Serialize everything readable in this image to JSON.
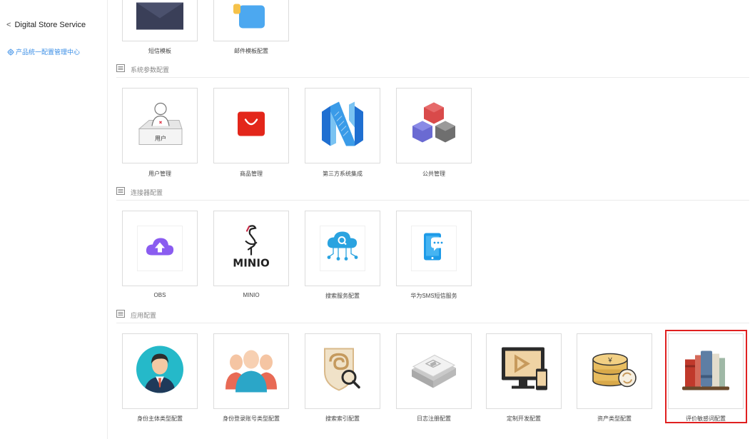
{
  "sidebar": {
    "back_label": "Digital Store Service",
    "config_center_label": "产品统一配置管理中心"
  },
  "sections": [
    {
      "title": "系统参数配置"
    },
    {
      "title": "连接器配置"
    },
    {
      "title": "应用配置"
    }
  ],
  "top_row": [
    {
      "label": "短信模板",
      "icon": "sms-template-icon"
    },
    {
      "label": "邮件模板配置",
      "icon": "email-template-icon"
    }
  ],
  "system_params": [
    {
      "label": "用户管理",
      "icon": "user-box-icon",
      "icon_text": "用户"
    },
    {
      "label": "商品管理",
      "icon": "shopping-bag-icon"
    },
    {
      "label": "第三方系统集成",
      "icon": "n-logo-icon"
    },
    {
      "label": "公共管理",
      "icon": "cubes-icon"
    }
  ],
  "connectors": [
    {
      "label": "OBS",
      "icon": "cloud-upload-icon"
    },
    {
      "label": "MINIO",
      "icon": "minio-logo-icon",
      "icon_text": "MINIO"
    },
    {
      "label": "搜索服务配置",
      "icon": "search-cloud-icon"
    },
    {
      "label": "华为SMS短信服务",
      "icon": "phone-chat-icon"
    }
  ],
  "apps": [
    {
      "label": "身份主体类型配置",
      "icon": "person-avatar-icon"
    },
    {
      "label": "身份登录账号类型配置",
      "icon": "people-group-icon"
    },
    {
      "label": "搜索索引配置",
      "icon": "shield-search-icon"
    },
    {
      "label": "日志注册配置",
      "icon": "log-device-icon"
    },
    {
      "label": "定制开发配置",
      "icon": "monitor-play-icon"
    },
    {
      "label": "资产类型配置",
      "icon": "coins-icon",
      "icon_text": "￥"
    },
    {
      "label": "评价敏感词配置",
      "icon": "books-icon"
    }
  ],
  "colors": {
    "accent": "#3a8ee6",
    "highlight": "#e02020"
  }
}
